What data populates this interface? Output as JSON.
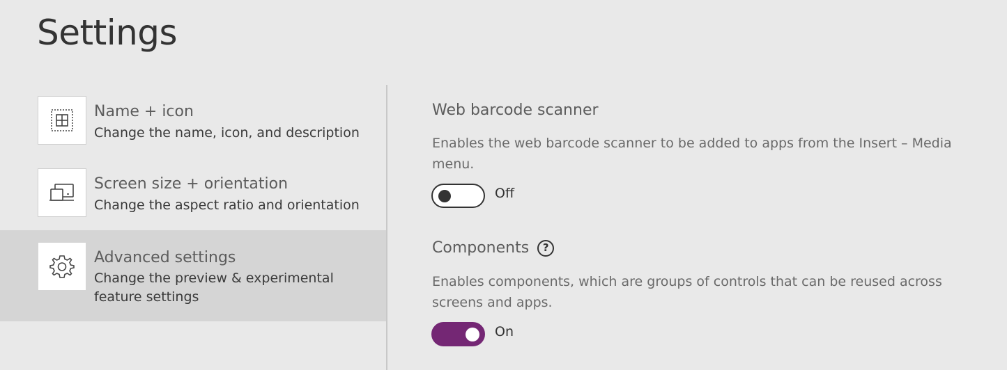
{
  "page": {
    "title": "Settings"
  },
  "nav": {
    "items": [
      {
        "label": "Name + icon",
        "description": "Change the name, icon, and description",
        "icon": "app-tile-icon",
        "selected": false
      },
      {
        "label": "Screen size + orientation",
        "description": "Change the aspect ratio and orientation",
        "icon": "devices-icon",
        "selected": false
      },
      {
        "label": "Advanced settings",
        "description": "Change the preview & experimental feature settings",
        "icon": "gear-icon",
        "selected": true
      }
    ]
  },
  "settings": {
    "web_barcode": {
      "title": "Web barcode scanner",
      "description": "Enables the web barcode scanner to be added to apps from the Insert – Media menu.",
      "state": "Off"
    },
    "components": {
      "title": "Components",
      "help_icon": "question-circle-icon",
      "description": "Enables components, which are groups of controls that can be reused across screens and apps.",
      "state": "On"
    }
  },
  "colors": {
    "accent": "#742774",
    "selected_bg": "#d5d5d5",
    "page_bg": "#e9e9e9"
  }
}
